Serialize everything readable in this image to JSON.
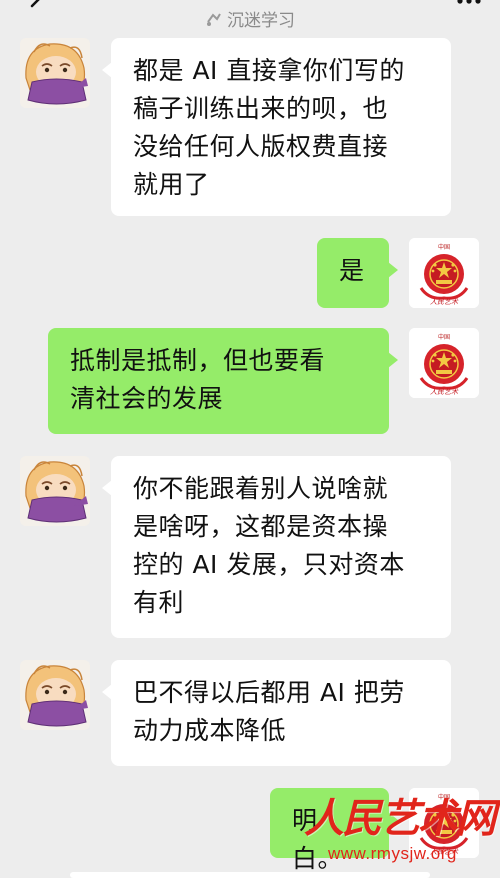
{
  "header": {
    "title": "",
    "subtitle": "沉迷学习",
    "back_icon": "chevron-left-icon",
    "more_icon": "more-dots-icon"
  },
  "messages": [
    {
      "side": "in",
      "text": "都是AI直接拿你们写的稿子训练出来的呗，也没给任何人版权费直接就用了",
      "lines": [
        "都是 AI 直接拿你们写的",
        "稿子训练出来的呗，也",
        "没给任何人版权费直接",
        "就用了"
      ]
    },
    {
      "side": "out",
      "text": "是",
      "lines": [
        "是"
      ]
    },
    {
      "side": "out",
      "text": "抵制是抵制，但也要看清社会的发展",
      "lines": [
        "抵制是抵制，但也要看",
        "清社会的发展"
      ]
    },
    {
      "side": "in",
      "text": "你不能跟着别人说啥就是啥呀，这都是资本操控的AI发展，只对资本有利",
      "lines": [
        "你不能跟着别人说啥就",
        "是啥呀，这都是资本操",
        "控的 AI 发展，只对资本",
        "有利"
      ]
    },
    {
      "side": "in",
      "text": "巴不得以后都用AI把劳动力成本降低",
      "lines": [
        "巴不得以后都用 AI 把劳",
        "动力成本降低"
      ]
    },
    {
      "side": "out",
      "text": "明白。",
      "lines": [
        "明白。"
      ]
    }
  ],
  "avatars": {
    "contact": "cartoon-avatar-icon",
    "self": "national-emblem-icon"
  },
  "watermark": {
    "logo": "人民艺术网",
    "url": "www.rmysjw.org"
  },
  "colors": {
    "background": "#ededed",
    "incoming_bubble": "#ffffff",
    "outgoing_bubble": "#95ec69",
    "watermark": "#e1251b"
  }
}
